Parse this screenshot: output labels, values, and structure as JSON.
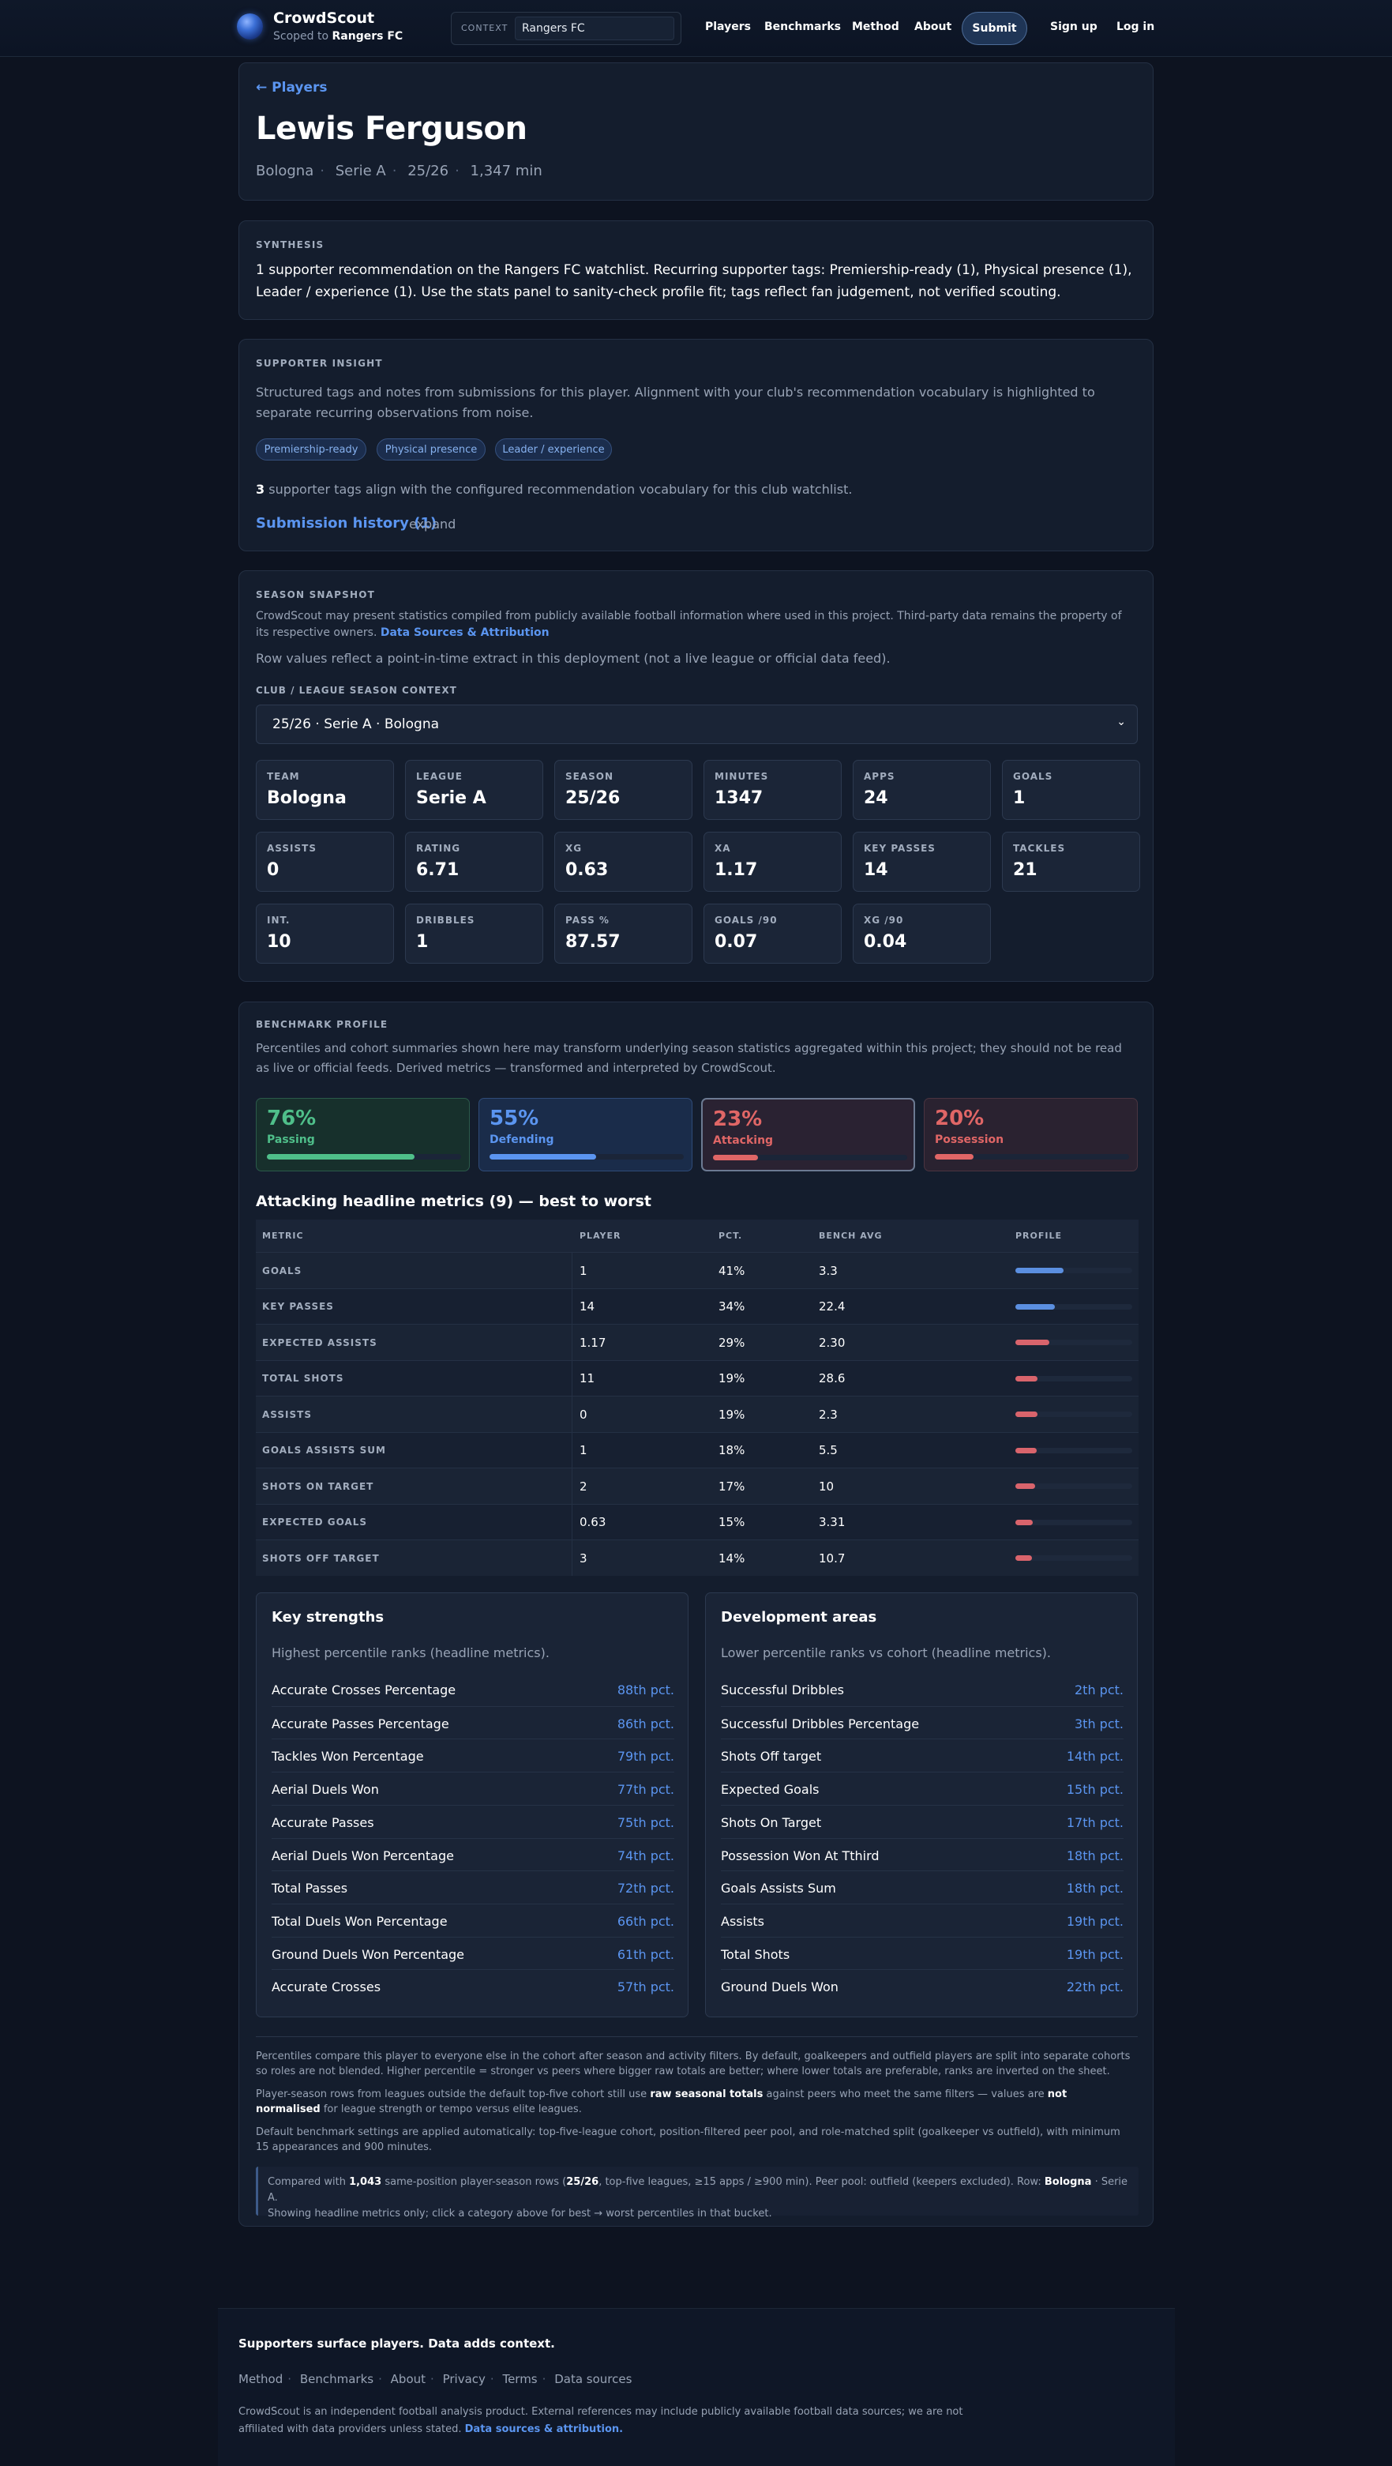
{
  "header": {
    "brand": "CrowdScout",
    "scoped_prefix": "Scoped to",
    "scoped_club": "Rangers FC",
    "context_label": "CONTEXT",
    "context_value": "Rangers FC",
    "nav": [
      "Players",
      "Benchmarks",
      "Method",
      "About"
    ],
    "submit": "Submit",
    "signup": "Sign up",
    "login": "Log in"
  },
  "hero": {
    "back": "← Players",
    "name": "Lewis Ferguson",
    "meta": [
      "Bologna",
      "Serie A",
      "25/26",
      "1,347 min"
    ]
  },
  "synthesis": {
    "label": "SYNTHESIS",
    "text": "1 supporter recommendation on the Rangers FC watchlist. Recurring supporter tags: Premiership-ready (1), Physical presence (1), Leader / experience (1). Use the stats panel to sanity-check profile fit; tags reflect fan judgement, not verified scouting."
  },
  "insight": {
    "label": "SUPPORTER INSIGHT",
    "description": "Structured tags and notes from submissions for this player. Alignment with your club's recommendation vocabulary is highlighted to separate recurring observations from noise.",
    "tags": [
      "Premiership-ready",
      "Physical presence",
      "Leader / experience"
    ],
    "align_count": "3",
    "align_text": "supporter tags align with the configured recommendation vocabulary for this club watchlist.",
    "history_link": "Submission history (1)",
    "expand": "expand"
  },
  "season": {
    "label": "SEASON SNAPSHOT",
    "attribution": "CrowdScout may present statistics compiled from publicly available football information where used in this project. Third-party data remains the property of its respective owners.",
    "attribution_link": "Data Sources & Attribution",
    "note": "Row values reflect a point-in-time extract in this deployment (not a live league or official data feed).",
    "context_label": "CLUB / LEAGUE SEASON CONTEXT",
    "context_value": "25/26 · Serie A · Bologna",
    "stats": [
      {
        "label": "TEAM",
        "value": "Bologna"
      },
      {
        "label": "LEAGUE",
        "value": "Serie A"
      },
      {
        "label": "SEASON",
        "value": "25/26"
      },
      {
        "label": "MINUTES",
        "value": "1347"
      },
      {
        "label": "APPS",
        "value": "24"
      },
      {
        "label": "GOALS",
        "value": "1"
      },
      {
        "label": "ASSISTS",
        "value": "0"
      },
      {
        "label": "RATING",
        "value": "6.71"
      },
      {
        "label": "XG",
        "value": "0.63"
      },
      {
        "label": "XA",
        "value": "1.17"
      },
      {
        "label": "KEY PASSES",
        "value": "14"
      },
      {
        "label": "TACKLES",
        "value": "21"
      },
      {
        "label": "INT.",
        "value": "10"
      },
      {
        "label": "DRIBBLES",
        "value": "1"
      },
      {
        "label": "PASS %",
        "value": "87.57"
      },
      {
        "label": "GOALS /90",
        "value": "0.07"
      },
      {
        "label": "XG /90",
        "value": "0.04"
      }
    ]
  },
  "benchmark": {
    "label": "BENCHMARK PROFILE",
    "description": "Percentiles and cohort summaries shown here may transform underlying season statistics aggregated within this project; they should not be read as live or official feeds. Derived metrics — transformed and interpreted by CrowdScout.",
    "categories": [
      {
        "pct": "76%",
        "name": "Passing",
        "fill": 0.76,
        "color": "#4fbf8a",
        "bg": "#17302c",
        "border": "#2b5a4a"
      },
      {
        "pct": "55%",
        "name": "Defending",
        "fill": 0.55,
        "color": "#5b95f0",
        "bg": "#1a2c4a",
        "border": "#2f4b78"
      },
      {
        "pct": "23%",
        "name": "Attacking",
        "fill": 0.23,
        "color": "#e06666",
        "bg": "#2a2232",
        "border": "#6c7a92"
      },
      {
        "pct": "20%",
        "name": "Possession",
        "fill": 0.2,
        "color": "#e06666",
        "bg": "#2a2230",
        "border": "#4a3440"
      }
    ],
    "metrics_title": "Attacking headline metrics (9) — best to worst",
    "columns": [
      "METRIC",
      "PLAYER",
      "PCT.",
      "BENCH AVG",
      "PROFILE"
    ],
    "rows": [
      {
        "metric": "GOALS",
        "player": "1",
        "pct": "41%",
        "avg": "3.3",
        "fill": 0.41,
        "color": "#5b8fe0"
      },
      {
        "metric": "KEY PASSES",
        "player": "14",
        "pct": "34%",
        "avg": "22.4",
        "fill": 0.34,
        "color": "#5b8fe0"
      },
      {
        "metric": "EXPECTED ASSISTS",
        "player": "1.17",
        "pct": "29%",
        "avg": "2.30",
        "fill": 0.29,
        "color": "#d9646c"
      },
      {
        "metric": "TOTAL SHOTS",
        "player": "11",
        "pct": "19%",
        "avg": "28.6",
        "fill": 0.19,
        "color": "#d9646c"
      },
      {
        "metric": "ASSISTS",
        "player": "0",
        "pct": "19%",
        "avg": "2.3",
        "fill": 0.19,
        "color": "#d9646c"
      },
      {
        "metric": "GOALS ASSISTS SUM",
        "player": "1",
        "pct": "18%",
        "avg": "5.5",
        "fill": 0.18,
        "color": "#d9646c"
      },
      {
        "metric": "SHOTS ON TARGET",
        "player": "2",
        "pct": "17%",
        "avg": "10",
        "fill": 0.17,
        "color": "#d9646c"
      },
      {
        "metric": "EXPECTED GOALS",
        "player": "0.63",
        "pct": "15%",
        "avg": "3.31",
        "fill": 0.15,
        "color": "#d9646c"
      },
      {
        "metric": "SHOTS OFF TARGET",
        "player": "3",
        "pct": "14%",
        "avg": "10.7",
        "fill": 0.14,
        "color": "#d9646c"
      }
    ],
    "strengths": {
      "title": "Key strengths",
      "subtitle": "Highest percentile ranks (headline metrics).",
      "items": [
        {
          "name": "Accurate Crosses Percentage",
          "pct": "88th pct."
        },
        {
          "name": "Accurate Passes Percentage",
          "pct": "86th pct."
        },
        {
          "name": "Tackles Won Percentage",
          "pct": "79th pct."
        },
        {
          "name": "Aerial Duels Won",
          "pct": "77th pct."
        },
        {
          "name": "Accurate Passes",
          "pct": "75th pct."
        },
        {
          "name": "Aerial Duels Won Percentage",
          "pct": "74th pct."
        },
        {
          "name": "Total Passes",
          "pct": "72th pct."
        },
        {
          "name": "Total Duels Won Percentage",
          "pct": "66th pct."
        },
        {
          "name": "Ground Duels Won Percentage",
          "pct": "61th pct."
        },
        {
          "name": "Accurate Crosses",
          "pct": "57th pct."
        }
      ]
    },
    "development": {
      "title": "Development areas",
      "subtitle": "Lower percentile ranks vs cohort (headline metrics).",
      "items": [
        {
          "name": "Successful Dribbles",
          "pct": "2th pct."
        },
        {
          "name": "Successful Dribbles Percentage",
          "pct": "3th pct."
        },
        {
          "name": "Shots Off target",
          "pct": "14th pct."
        },
        {
          "name": "Expected Goals",
          "pct": "15th pct."
        },
        {
          "name": "Shots On Target",
          "pct": "17th pct."
        },
        {
          "name": "Possession Won At Tthird",
          "pct": "18th pct."
        },
        {
          "name": "Goals Assists Sum",
          "pct": "18th pct."
        },
        {
          "name": "Assists",
          "pct": "19th pct."
        },
        {
          "name": "Total Shots",
          "pct": "19th pct."
        },
        {
          "name": "Ground Duels Won",
          "pct": "22th pct."
        }
      ]
    },
    "footnote1": "Percentiles compare this player to everyone else in the cohort after season and activity filters. By default, goalkeepers and outfield players are split into separate cohorts so roles are not blended. Higher percentile = stronger vs peers where bigger raw totals are better; where lower totals are preferable, ranks are inverted on the sheet.",
    "footnote2_a": "Player-season rows from leagues outside the default top-five cohort still use",
    "footnote2_b": "raw seasonal totals",
    "footnote2_c": "against peers who meet the same filters — values are",
    "footnote2_d": "not normalised",
    "footnote2_e": "for league strength or tempo versus elite leagues.",
    "footnote3": "Default benchmark settings are applied automatically: top-five-league cohort, position-filtered peer pool, and role-matched split (goalkeeper vs outfield), with minimum 15 appearances and 900 minutes.",
    "compare_a": "Compared with",
    "compare_count": "1,043",
    "compare_b": "same-position player-season rows (",
    "compare_season": "25/26",
    "compare_c": ", top-five leagues, ≥15 apps / ≥900 min). Peer pool: outfield (keepers excluded). Row:",
    "compare_club": "Bologna",
    "compare_d": "· Serie A.",
    "compare_line2": "Showing headline metrics only; click a category above for best → worst percentiles in that bucket."
  },
  "footer": {
    "tagline": "Supporters surface players. Data adds context.",
    "links": [
      "Method",
      "Benchmarks",
      "About",
      "Privacy",
      "Terms",
      "Data sources"
    ],
    "text": "CrowdScout is an independent football analysis product. External references may include publicly available football data sources; we are not affiliated with data providers unless stated.",
    "text_link": "Data sources & attribution."
  }
}
